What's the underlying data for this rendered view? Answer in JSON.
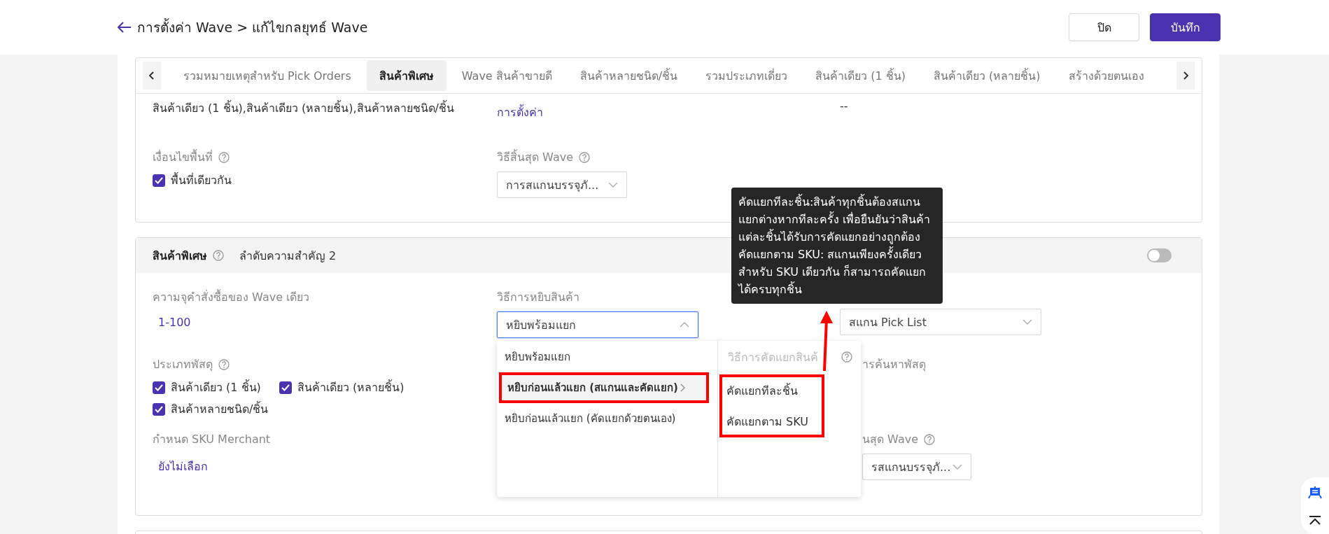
{
  "header": {
    "title": "การตั้งค่า Wave > แก้ไขกลยุทธ์ Wave",
    "buttons": [
      {
        "label": "ปิด",
        "kind": "secondary"
      },
      {
        "label": "บันทึก",
        "kind": "primary"
      }
    ]
  },
  "tabs": [
    {
      "label": "รวมหมายเหตุสำหรับ Pick Orders",
      "selected": false
    },
    {
      "label": "สินค้าพิเศษ",
      "selected": true
    },
    {
      "label": "Wave สินค้าขายดี",
      "selected": false
    },
    {
      "label": "สินค้าหลายชนิด/ชิ้น",
      "selected": false
    },
    {
      "label": "รวมประเภทเดี่ยว",
      "selected": false
    },
    {
      "label": "สินค้าเดียว (1 ชิ้น)",
      "selected": false
    },
    {
      "label": "สินค้าเดียว (หลายชิ้น)",
      "selected": false
    },
    {
      "label": "สร้างด้วยตนเอง",
      "selected": false
    }
  ],
  "top_card": {
    "product_types": "สินค้าเดียว (1 ชิ้น),สินค้าเดียว (หลายชิ้น),สินค้าหลายชนิด/ชิ้น",
    "settings_link": "การตั้งค่า",
    "column_3": "--",
    "area_condition": {
      "label": "เงื่อนไขพื้นที่",
      "option": {
        "label": "พื้นที่เดียวกัน",
        "checked": true
      }
    },
    "wave_end": {
      "label": "วิธีสิ้นสุด Wave",
      "value": "การสแกนบรรจุภั..."
    }
  },
  "special_card": {
    "title": "สินค้าพิเศษ",
    "priority": "ลำดับความสำคัญ 2",
    "on": false,
    "order_range": {
      "label": "ความจุคำสั่งซื้อของ Wave เดียว",
      "value": "1-100"
    },
    "picking_method": {
      "label": "วิธีการหยิบสินค้า",
      "value": "หยิบพร้อมแยก",
      "expanded": true
    },
    "print_select": {
      "value": "สแกน Pick List"
    },
    "parcel_type": {
      "label": "ประเภทพัสดุ",
      "options": [
        {
          "label": "สินค้าเดียว (1 ชิ้น)",
          "checked": true
        },
        {
          "label": "สินค้าเดียว (หลายชิ้น)",
          "checked": true
        },
        {
          "label": "สินค้าหลายชนิด/ชิ้น",
          "checked": true
        }
      ]
    },
    "parcel_search": {
      "label": "ารค้นหาพัสดุ"
    },
    "sku_merchant": {
      "label": "กำหนด SKU Merchant",
      "value": "ยังไม่เลือก"
    },
    "wave_end": {
      "label": "นสุด Wave",
      "value": "รสแกนบรรจุภั..."
    }
  },
  "dropdown": {
    "options": [
      {
        "label": "หยิบพร้อมแยก",
        "selected": false,
        "has_submenu": false
      },
      {
        "label": "หยิบก่อนแล้วแยก (สแกนและคัดแยก)",
        "selected": true,
        "has_submenu": true
      },
      {
        "label": "หยิบก่อนแล้วแยก (คัดแยกด้วยตนเอง)",
        "selected": false,
        "has_submenu": false
      }
    ],
    "submenu": {
      "title": "วิธีการคัดแยกสินค้",
      "options": [
        "คัดแยกทีละชิ้น",
        "คัดแยกตาม SKU"
      ]
    }
  },
  "tooltip": {
    "paragraphs": [
      "คัดแยกทีละชิ้น:สินค้าทุกชิ้นต้องสแกนแยกต่างหากทีละครั้ง เพื่อยืนยันว่าสินค้าแต่ละชิ้นได้รับการคัดแยกอย่างถูกต้อง",
      "คัดแยกตาม SKU: สแกนเพียงครั้งเดียวสำหรับ SKU เดียวกัน ก็สามารถคัดแยกได้ครบทุกชิ้น"
    ]
  }
}
